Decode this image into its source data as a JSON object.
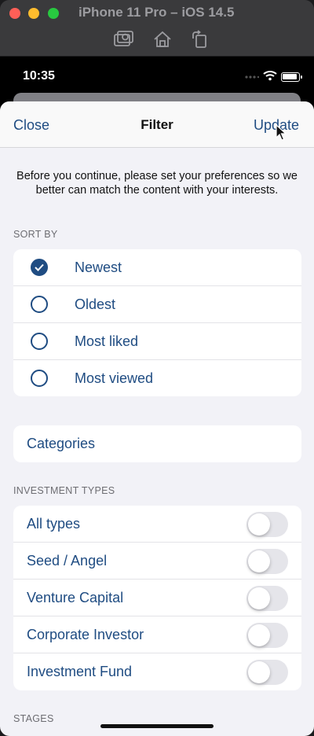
{
  "window": {
    "title": "iPhone 11 Pro – iOS 14.5",
    "toolbar_icons": [
      "screenshot-icon",
      "home-icon",
      "rotate-icon"
    ]
  },
  "status_bar": {
    "time": "10:35"
  },
  "nav": {
    "left": "Close",
    "title": "Filter",
    "right": "Update"
  },
  "intro_text": "Before you continue, please set your preferences so we better can match the content with your interests.",
  "sort_by": {
    "header": "SORT BY",
    "options": [
      {
        "label": "Newest",
        "selected": true
      },
      {
        "label": "Oldest",
        "selected": false
      },
      {
        "label": "Most liked",
        "selected": false
      },
      {
        "label": "Most viewed",
        "selected": false
      }
    ]
  },
  "categories": {
    "label": "Categories"
  },
  "investment_types": {
    "header": "INVESTMENT TYPES",
    "items": [
      {
        "label": "All types",
        "on": false
      },
      {
        "label": "Seed / Angel",
        "on": false
      },
      {
        "label": "Venture Capital",
        "on": false
      },
      {
        "label": "Corporate Investor",
        "on": false
      },
      {
        "label": "Investment Fund",
        "on": false
      }
    ]
  },
  "stages": {
    "header": "STAGES"
  },
  "colors": {
    "accent": "#1f4c82",
    "background": "#f2f2f7",
    "switch_off": "#e5e5ea"
  }
}
